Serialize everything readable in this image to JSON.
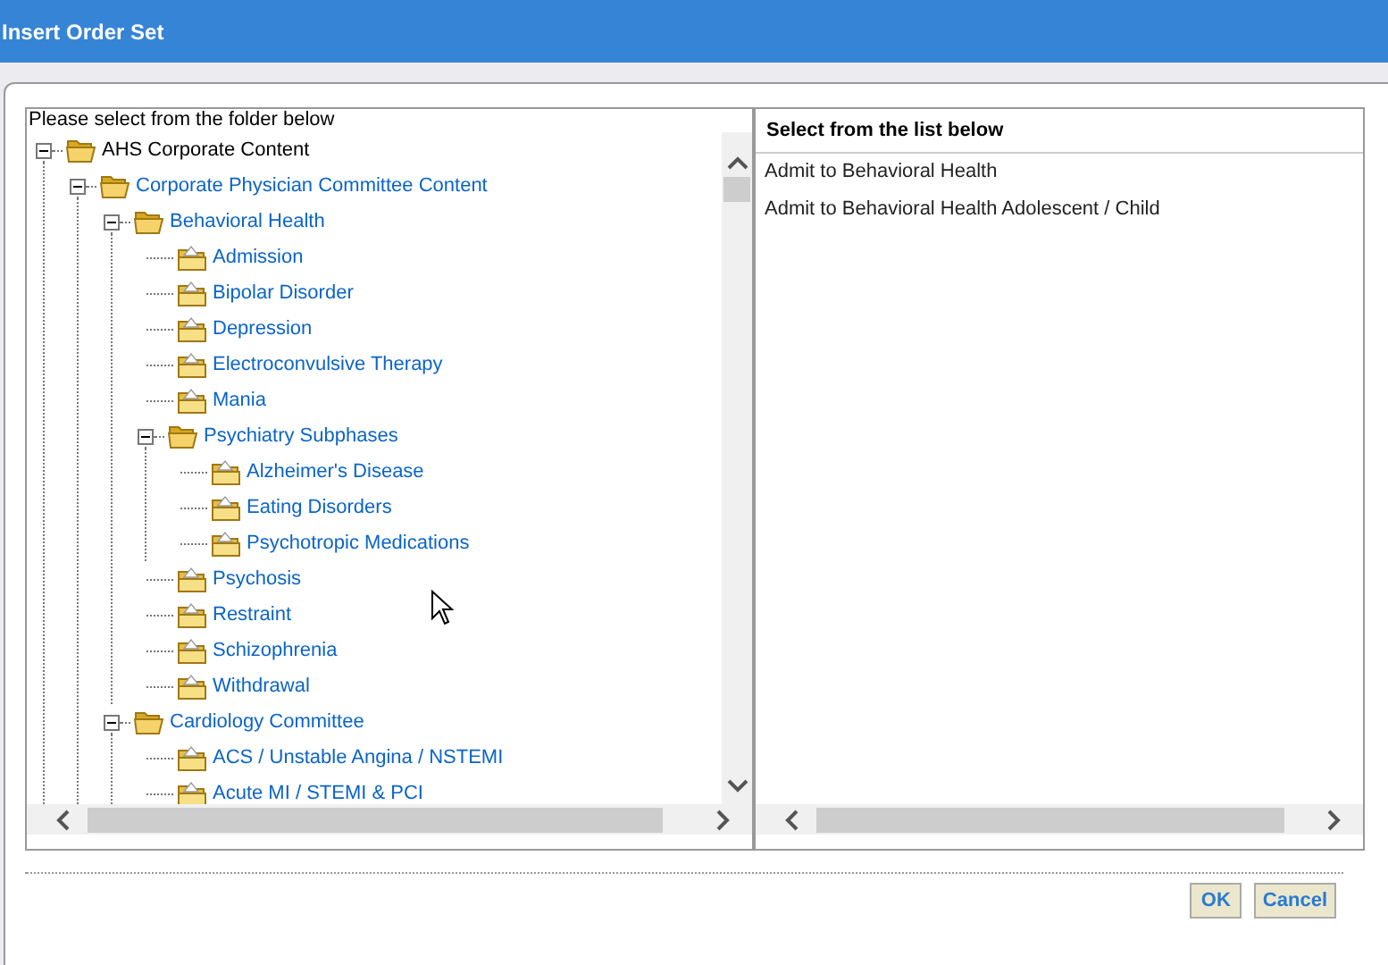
{
  "window": {
    "title": "Insert Order Set"
  },
  "folder_pane": {
    "heading": "Please select from the folder below",
    "tree": [
      {
        "label": "AHS Corporate Content",
        "expanded": true,
        "children": [
          {
            "label": "Corporate Physician Committee Content",
            "expanded": true,
            "children": [
              {
                "label": "Behavioral Health",
                "expanded": true,
                "children": [
                  {
                    "label": "Admission"
                  },
                  {
                    "label": "Bipolar Disorder"
                  },
                  {
                    "label": "Depression"
                  },
                  {
                    "label": "Electroconvulsive Therapy"
                  },
                  {
                    "label": "Mania"
                  },
                  {
                    "label": "Psychiatry Subphases",
                    "expanded": true,
                    "children": [
                      {
                        "label": "Alzheimer's Disease"
                      },
                      {
                        "label": "Eating Disorders"
                      },
                      {
                        "label": "Psychotropic Medications"
                      }
                    ]
                  },
                  {
                    "label": "Psychosis"
                  },
                  {
                    "label": "Restraint"
                  },
                  {
                    "label": "Schizophrenia"
                  },
                  {
                    "label": "Withdrawal"
                  }
                ]
              },
              {
                "label": "Cardiology Committee",
                "expanded": true,
                "children": [
                  {
                    "label": "ACS / Unstable Angina / NSTEMI"
                  },
                  {
                    "label": "Acute MI / STEMI & PCI"
                  }
                ]
              }
            ]
          }
        ]
      }
    ]
  },
  "list_pane": {
    "heading": "Select from the list below",
    "items": [
      "Admit to Behavioral Health",
      "Admit to Behavioral Health Adolescent / Child"
    ]
  },
  "buttons": [
    "OK",
    "Cancel"
  ]
}
